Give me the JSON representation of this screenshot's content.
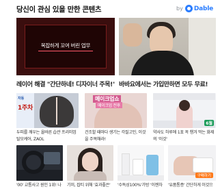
{
  "header": {
    "title": "당신이 관심 있을 만한 콘텐츠",
    "by": "by",
    "brand_name": "Dable"
  },
  "top_cards": [
    {
      "overlay_text": "복잡하게 꼬여 버린 업무",
      "caption": "레이어 해결 \"간단하네! 디자이너 주목!\""
    },
    {
      "caption": "바바요에서는 가입만하면 모두 무료!"
    }
  ],
  "grid_row1": [
    {
      "thumb_top_text": "자동",
      "thumb_badge": "1주차",
      "caption": "두피를 깨우는 올바른 습관 프리미엄 탈모케어, ZAOL"
    },
    {
      "thumb_title": "메이크업쇼",
      "thumb_sub": "메이크업 전후",
      "caption": "건조할 때마다 생기는 각질고민, 이것을 주목해라!"
    },
    {
      "thumb_tag": "6월",
      "caption": "약사도 하루에 1포 꼭 챙겨 먹는 화제의 '이것'"
    }
  ],
  "grid_row2": [
    {
      "caption": "'00' 교통사고 원인 1위! 나한 사고를 위한 이야"
    },
    {
      "caption": "기미, 잡티 위해 '효과좋은' 7일 사용 실력 확인"
    },
    {
      "caption": "'수독성100%'가방 '이젠차림' 함께 만든 결상이 공조"
    },
    {
      "thumb_button": "구매하기",
      "caption": "'유품통증' 간단하게 이것으로 수술 없이 해결!"
    }
  ],
  "colors": {
    "brand": "#2a7dff"
  }
}
